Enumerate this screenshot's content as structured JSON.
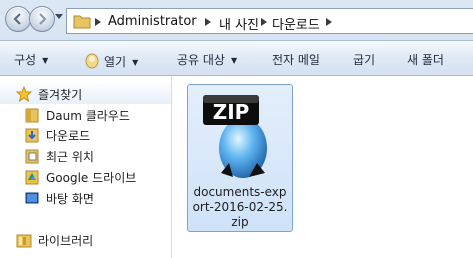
{
  "address": {
    "crumbs": [
      "Administrator",
      "내 사진",
      "다운로드"
    ]
  },
  "toolbar": {
    "organize": "구성",
    "open": "열기",
    "share": "공유 대상",
    "email": "전자 메일",
    "burn": "굽기",
    "new_folder": "새 폴더"
  },
  "sidebar": {
    "favorites": "즐겨찾기",
    "items": [
      {
        "label": "Daum 클라우드",
        "icon": "folder-icon"
      },
      {
        "label": "다운로드",
        "icon": "download-folder-icon"
      },
      {
        "label": "최근 위치",
        "icon": "recent-places-icon"
      },
      {
        "label": "Google 드라이브",
        "icon": "google-drive-icon"
      },
      {
        "label": "바탕 화면",
        "icon": "desktop-icon"
      }
    ],
    "libraries": "라이브러리"
  },
  "files": [
    {
      "name": "documents-export-2016-02-25.zip",
      "icon": "zip-archive-icon",
      "badge": "ZIP",
      "selected": true
    }
  ],
  "colors": {
    "selection_fill": "#cfe2f8",
    "selection_border": "#7da2ce",
    "toolbar_text": "#1e2b3c"
  }
}
